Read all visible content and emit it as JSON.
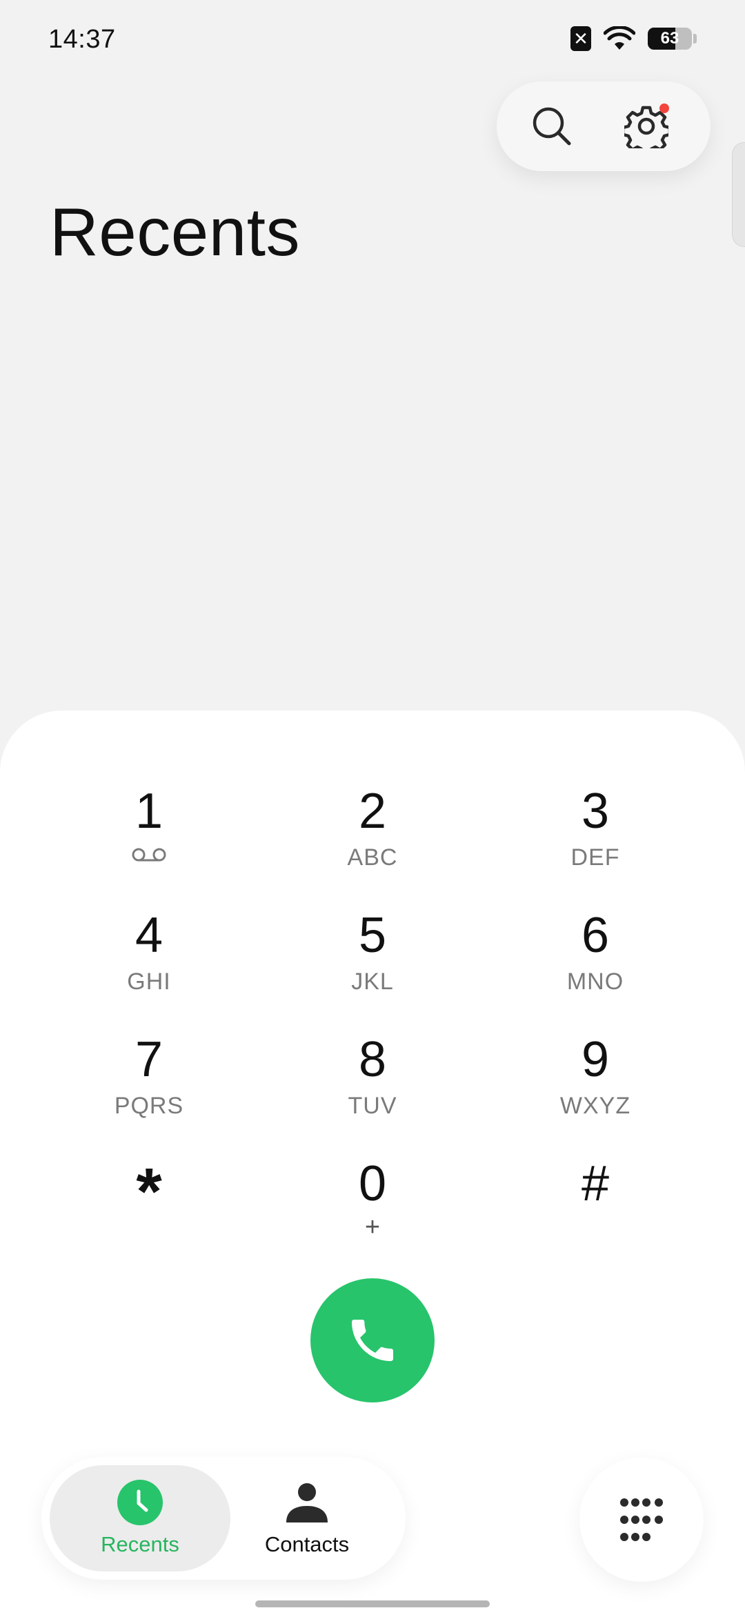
{
  "status_bar": {
    "time": "14:37",
    "sim_icon": "sim-error-icon",
    "wifi_icon": "wifi-icon",
    "battery_level": "63",
    "battery_fraction": 0.63
  },
  "header": {
    "title": "Recents",
    "search_icon": "search-icon",
    "settings_icon": "gear-icon",
    "settings_has_notification": true
  },
  "dialpad": {
    "keys": [
      {
        "digit": "1",
        "letters": "",
        "icon": "voicemail-icon"
      },
      {
        "digit": "2",
        "letters": "ABC"
      },
      {
        "digit": "3",
        "letters": "DEF"
      },
      {
        "digit": "4",
        "letters": "GHI"
      },
      {
        "digit": "5",
        "letters": "JKL"
      },
      {
        "digit": "6",
        "letters": "MNO"
      },
      {
        "digit": "7",
        "letters": "PQRS"
      },
      {
        "digit": "8",
        "letters": "TUV"
      },
      {
        "digit": "9",
        "letters": "WXYZ"
      },
      {
        "digit": "*",
        "letters": ""
      },
      {
        "digit": "0",
        "letters": "+"
      },
      {
        "digit": "#",
        "letters": ""
      }
    ],
    "call_icon": "phone-icon",
    "call_color": "#27c46b"
  },
  "bottom_nav": {
    "tabs": [
      {
        "label": "Recents",
        "icon": "clock-icon",
        "active": true
      },
      {
        "label": "Contacts",
        "icon": "person-icon",
        "active": false
      }
    ],
    "keypad_icon": "keypad-icon",
    "accent": "#27b55f"
  }
}
